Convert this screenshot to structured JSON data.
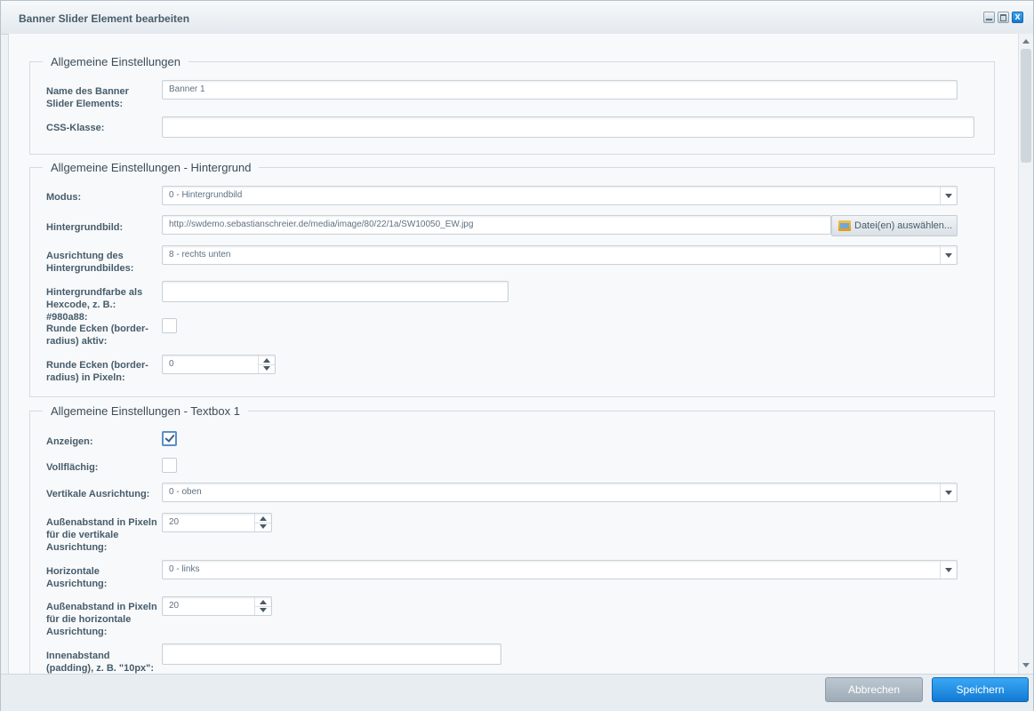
{
  "window": {
    "title": "Banner Slider Element bearbeiten",
    "close_glyph": "x"
  },
  "sections": [
    {
      "legend": "Allgemeine Einstellungen",
      "fields": {
        "name_label": "Name des Banner Slider Elements:",
        "name_value": "Banner 1",
        "css_label": "CSS-Klasse:",
        "css_value": ""
      }
    },
    {
      "legend": "Allgemeine Einstellungen - Hintergrund",
      "fields": {
        "modus_label": "Modus:",
        "modus_value": "0 - Hintergrundbild",
        "bild_label": "Hintergrundbild:",
        "bild_value": "http://swdemo.sebastianschreier.de/media/image/80/22/1a/SW10050_EW.jpg",
        "bild_button": "Datei(en) auswählen...",
        "ausrichtung_label": "Ausrichtung des Hintergrundbildes:",
        "ausrichtung_value": "8 - rechts unten",
        "farbe_label": "Hintergrundfarbe als Hexcode, z. B.: #980a88:",
        "farbe_value": "",
        "ecken_aktiv_label": "Runde Ecken (border-radius) aktiv:",
        "ecken_aktiv_checked": false,
        "ecken_px_label": "Runde Ecken (border-radius) in Pixeln:",
        "ecken_px_value": "0"
      }
    },
    {
      "legend": "Allgemeine Einstellungen - Textbox 1",
      "fields": {
        "anzeigen_label": "Anzeigen:",
        "anzeigen_checked": true,
        "vollflaechig_label": "Vollflächig:",
        "vollflaechig_checked": false,
        "vert_label": "Vertikale Ausrichtung:",
        "vert_value": "0 - oben",
        "vert_abstand_label": "Außenabstand in Pixeln für die vertikale Ausrichtung:",
        "vert_abstand_value": "20",
        "horiz_label": "Horizontale Ausrichtung:",
        "horiz_value": "0 - links",
        "horiz_abstand_label": "Außenabstand in Pixeln für die horizontale Ausrichtung:",
        "horiz_abstand_value": "20",
        "innen_label": "Innenabstand (padding), z. B. \"10px\":",
        "innen_value": ""
      }
    }
  ],
  "footer": {
    "cancel_label": "Abbrechen",
    "save_label": "Speichern"
  },
  "colors": {
    "accent": "#1a86dd",
    "cancel": "#a9b5bf",
    "text": "#475c6a"
  }
}
